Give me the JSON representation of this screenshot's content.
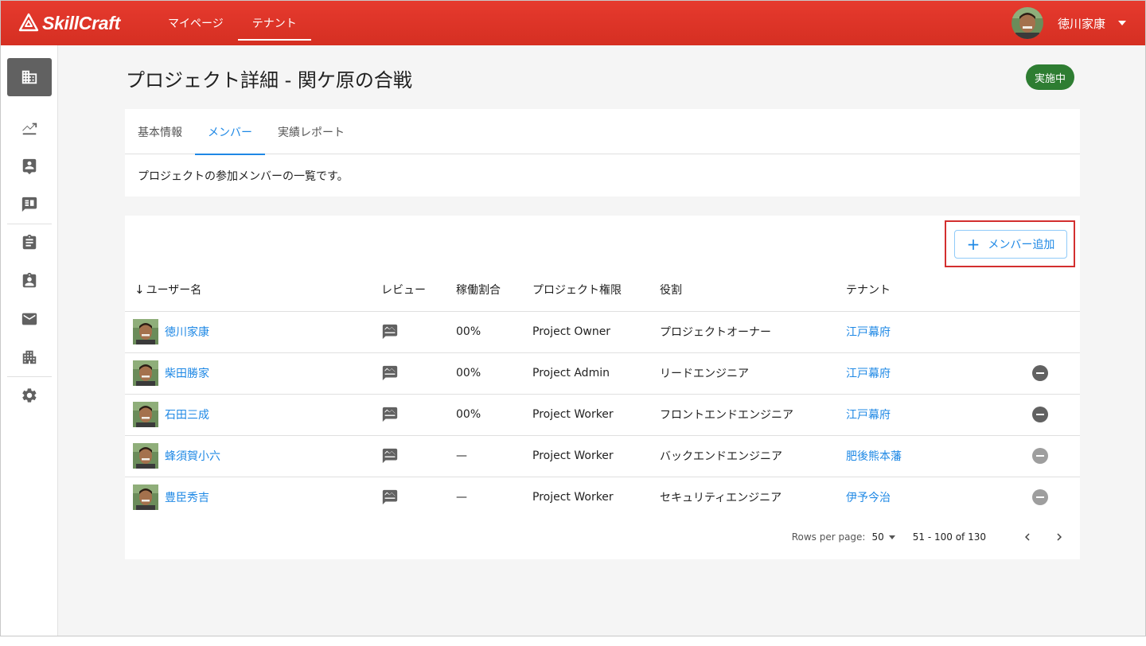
{
  "app": {
    "logo_text": "SkillCraft",
    "nav": [
      {
        "label": "マイページ",
        "active": false
      },
      {
        "label": "テナント",
        "active": true
      }
    ],
    "user_name": "徳川家康"
  },
  "sidebar": {
    "items": [
      {
        "icon": "building-icon",
        "active": true
      },
      {
        "icon": "trending-up-icon"
      },
      {
        "icon": "contact-card-icon"
      },
      {
        "icon": "book-icon"
      },
      {
        "icon": "clipboard-icon"
      },
      {
        "icon": "clipboard-user-icon"
      },
      {
        "icon": "mail-icon"
      },
      {
        "icon": "apartment-icon"
      },
      {
        "icon": "gear-icon"
      }
    ]
  },
  "page": {
    "title": "プロジェクト詳細 - 関ケ原の合戦",
    "status": "実施中",
    "status_color": "#2e7d32"
  },
  "tabs": [
    {
      "label": "基本情報",
      "active": false
    },
    {
      "label": "メンバー",
      "active": true
    },
    {
      "label": "実績レポート",
      "active": false
    }
  ],
  "tab_description": "プロジェクトの参加メンバーの一覧です。",
  "add_member_label": "メンバー追加",
  "table": {
    "headers": {
      "sort_arrow": "↓",
      "username": "ユーザー名",
      "review": "レビュー",
      "rate": "稼働割合",
      "permission": "プロジェクト権限",
      "role": "役割",
      "tenant": "テナント"
    },
    "rows": [
      {
        "name": "徳川家康",
        "rate": "00%",
        "permission": "Project Owner",
        "role": "プロジェクトオーナー",
        "tenant": "江戸幕府",
        "removable": false,
        "remove_disabled": false
      },
      {
        "name": "柴田勝家",
        "rate": "00%",
        "permission": "Project Admin",
        "role": "リードエンジニア",
        "tenant": "江戸幕府",
        "removable": true,
        "remove_disabled": false
      },
      {
        "name": "石田三成",
        "rate": "00%",
        "permission": "Project Worker",
        "role": "フロントエンドエンジニア",
        "tenant": "江戸幕府",
        "removable": true,
        "remove_disabled": false
      },
      {
        "name": "蜂須賀小六",
        "rate": "—",
        "permission": "Project Worker",
        "role": "バックエンドエンジニア",
        "tenant": "肥後熊本藩",
        "removable": true,
        "remove_disabled": true
      },
      {
        "name": "豊臣秀吉",
        "rate": "—",
        "permission": "Project Worker",
        "role": "セキュリティエンジニア",
        "tenant": "伊予今治",
        "removable": true,
        "remove_disabled": true
      }
    ]
  },
  "pagination": {
    "rows_per_page_label": "Rows per page:",
    "rows_per_page": "50",
    "range": "51 - 100 of 130"
  },
  "colors": {
    "header_red": "#d52f22",
    "link_blue": "#1e88e5",
    "highlight_red": "#d32f2f"
  }
}
